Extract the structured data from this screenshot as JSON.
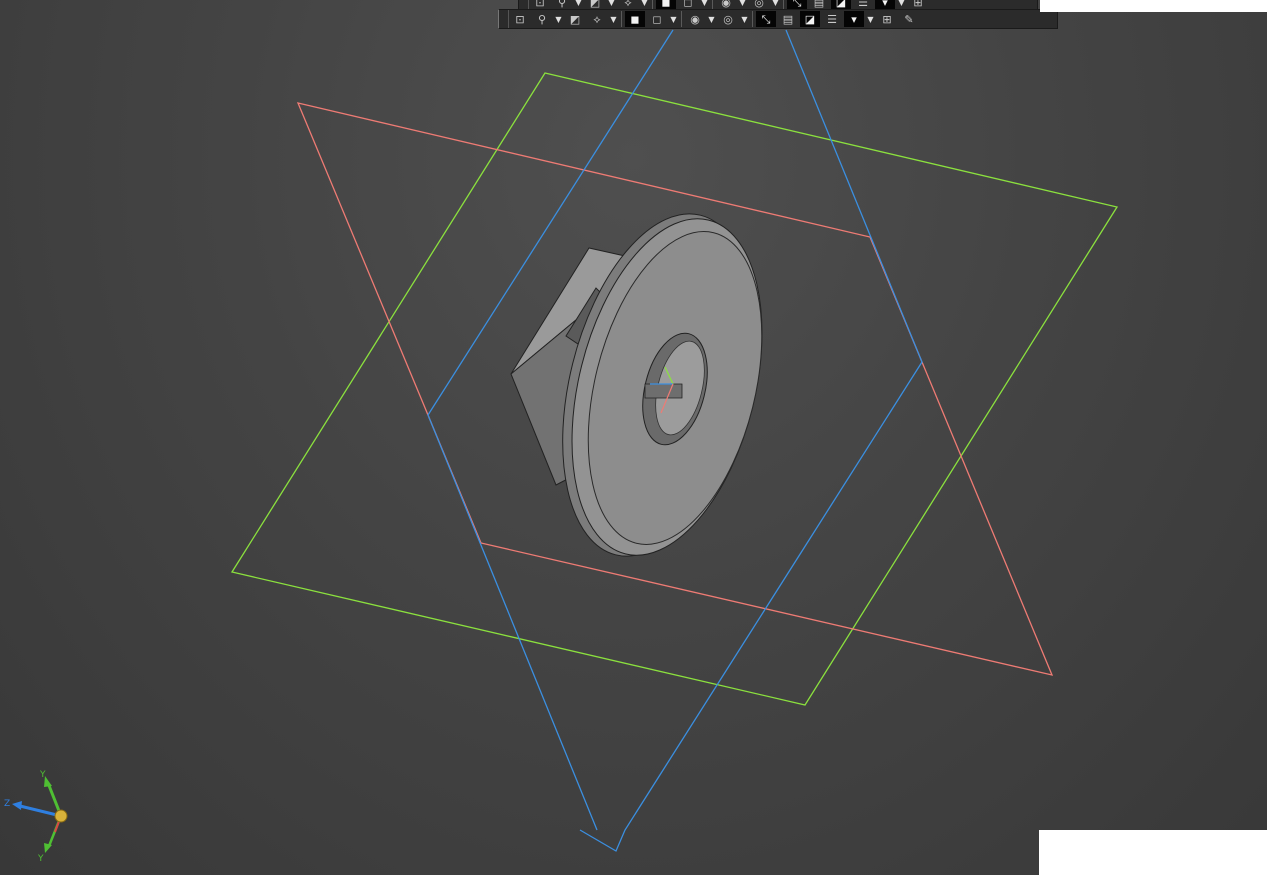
{
  "colors": {
    "viewport_top": "#4f4f4f",
    "viewport_bottom": "#383838",
    "plane_xy": "#8be13e",
    "plane_xz": "#ee7b74",
    "plane_yz": "#3b8fe0",
    "part_fill": "#8f8f8f",
    "part_edge": "#222222"
  },
  "toolbar_top": {
    "icons": [
      "zoom-fit-icon",
      "zoom-icon",
      "dropdown",
      "section-icon",
      "dropdown",
      "measure-icon",
      "dropdown",
      "shaded-cube-icon",
      "wire-cube-icon",
      "dropdown",
      "visibility-icon",
      "dropdown",
      "camera-icon",
      "dropdown",
      "dimension-icon",
      "sketch-icon",
      "hide-show-icon",
      "layers-icon",
      "filter-icon",
      "dropdown",
      "assembly-icon"
    ]
  },
  "toolbar_bottom": {
    "icons": [
      "zoom-fit-icon",
      "zoom-icon",
      "dropdown",
      "section-icon",
      "dropdown",
      "measure-icon",
      "dropdown",
      "shaded-cube-icon",
      "wire-cube-icon",
      "dropdown",
      "visibility-icon",
      "dropdown",
      "camera-icon",
      "dropdown",
      "dimension-icon",
      "sketch-icon",
      "hide-show-icon",
      "layers-icon",
      "filter-icon",
      "dropdown",
      "assembly-icon",
      "pen-icon"
    ]
  },
  "triad": {
    "x_label": "Z",
    "y_label": "Y",
    "z_label": "Y"
  }
}
